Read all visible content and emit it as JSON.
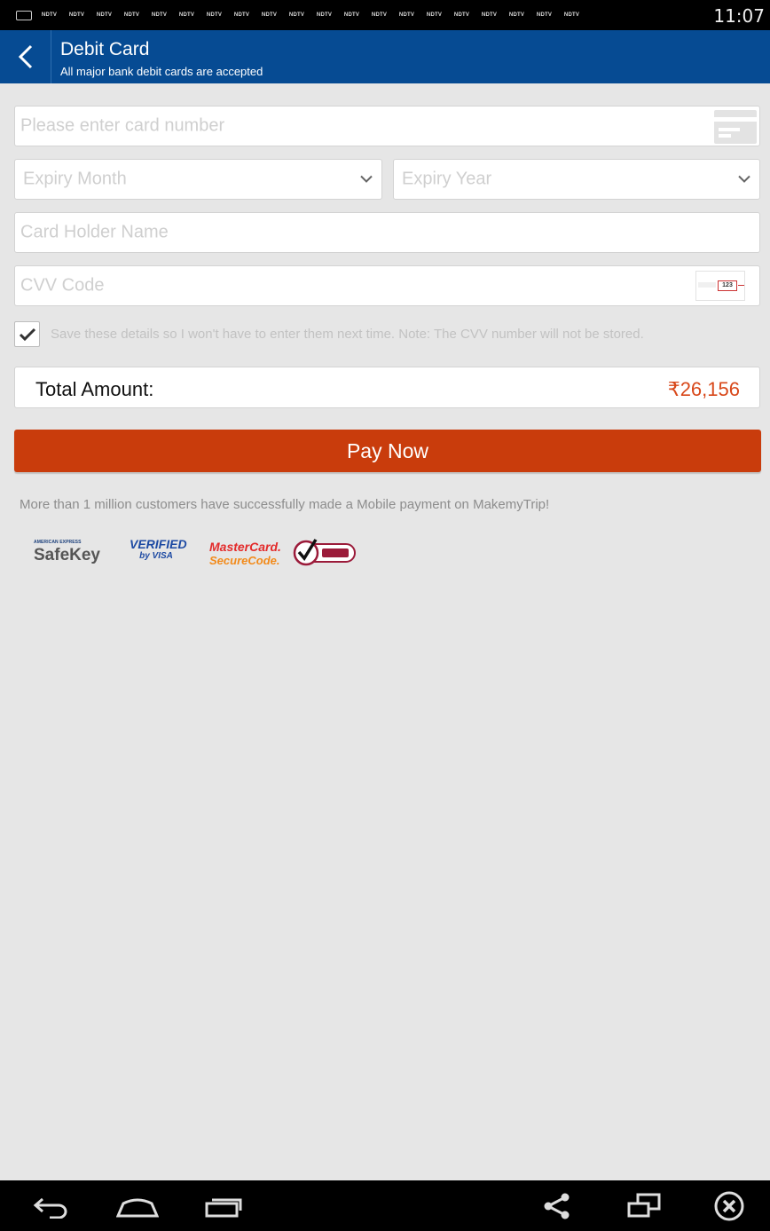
{
  "status_bar": {
    "time": "11:07",
    "notification_labels": [
      "NDTV",
      "NDTV",
      "NDTV",
      "NDTV",
      "NDTV",
      "NDTV",
      "NDTV",
      "NDTV",
      "NDTV",
      "NDTV",
      "NDTV",
      "NDTV",
      "NDTV",
      "NDTV",
      "NDTV",
      "NDTV",
      "NDTV",
      "NDTV",
      "NDTV",
      "NDTV"
    ]
  },
  "header": {
    "title": "Debit Card",
    "subtitle": "All major bank debit cards are accepted",
    "back_icon": "chevron-left-icon"
  },
  "form": {
    "card_number_placeholder": "Please enter card number",
    "expiry_month_placeholder": "Expiry Month",
    "expiry_year_placeholder": "Expiry Year",
    "card_holder_placeholder": "Card Holder Name",
    "cvv_placeholder": "CVV Code",
    "cvv_sample": "123",
    "save_details_checked": true,
    "save_details_label": "Save these details so I won't have to enter them next time. Note: The CVV number will not be stored."
  },
  "total": {
    "label": "Total Amount:",
    "value": "₹26,156"
  },
  "pay_button_label": "Pay Now",
  "info_text": "More than 1 million customers have successfully made a Mobile payment on MakemyTrip!",
  "security_logos": {
    "amex_top": "AMERICAN EXPRESS",
    "amex_main": "SafeKey",
    "visa_line1": "VERIFIED",
    "visa_line2": "by VISA",
    "mastercard_line1": "MasterCard.",
    "mastercard_line2": "SecureCode.",
    "verisign": "VeriSign Secured"
  },
  "colors": {
    "app_bar": "#064b93",
    "pay_button": "#c93c0c",
    "amount": "#d8481a",
    "background": "#e6e6e6"
  }
}
